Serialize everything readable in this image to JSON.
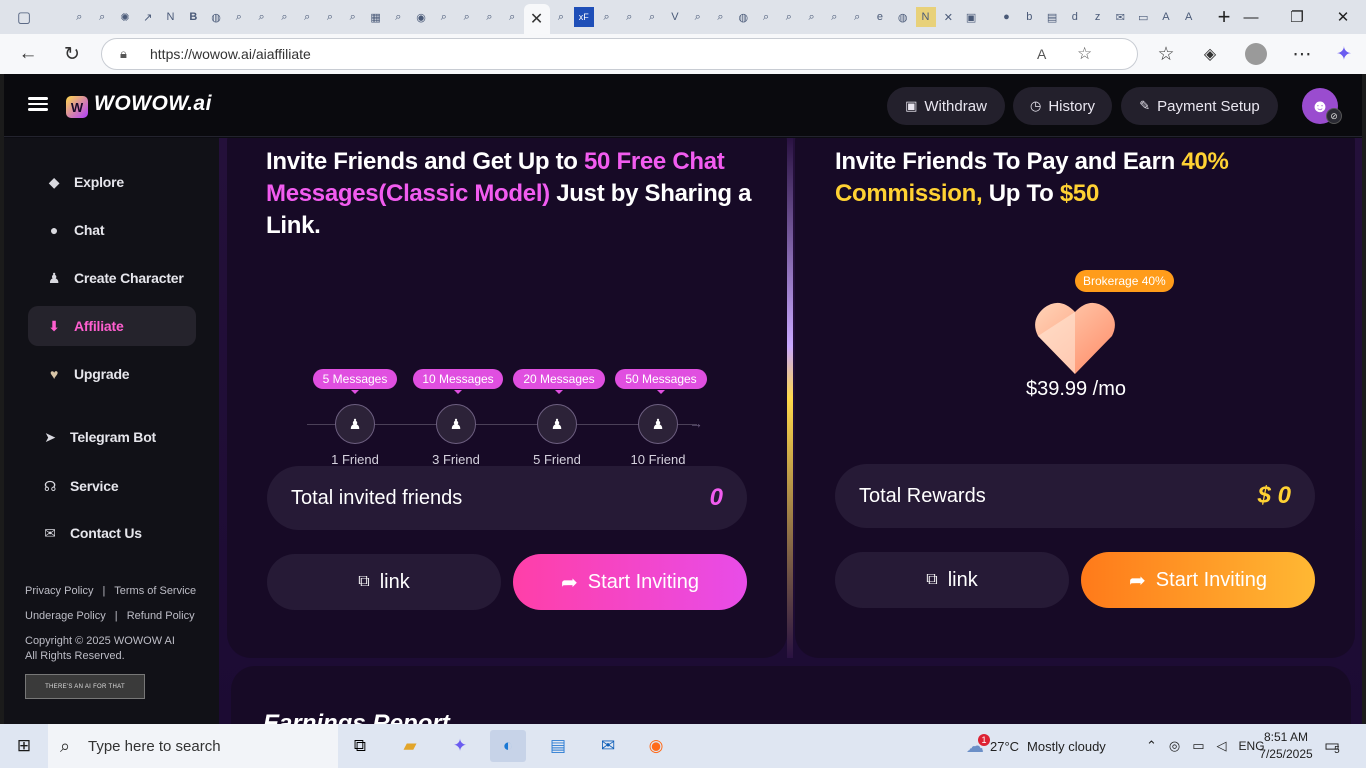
{
  "browser": {
    "url": "https://wowow.ai/aiaffiliate",
    "active_tab_close": "✕",
    "new_tab": "+",
    "win_minimize": "—",
    "win_restore": "❐",
    "win_close": "✕"
  },
  "header": {
    "logo": "WOWOW.ai",
    "buttons": [
      {
        "label": "Withdraw",
        "icon": "wallet-icon"
      },
      {
        "label": "History",
        "icon": "history-icon"
      },
      {
        "label": "Payment Setup",
        "icon": "edit-icon"
      }
    ]
  },
  "sidebar": {
    "items": [
      {
        "label": "Explore",
        "icon": "compass-icon"
      },
      {
        "label": "Chat",
        "icon": "chat-icon"
      },
      {
        "label": "Create Character",
        "icon": "user-icon"
      },
      {
        "label": "Affiliate",
        "icon": "affiliate-icon"
      },
      {
        "label": "Upgrade",
        "icon": "heart-icon"
      },
      {
        "label": "Telegram Bot",
        "icon": "telegram-icon"
      },
      {
        "label": "Service",
        "icon": "headset-icon"
      },
      {
        "label": "Contact Us",
        "icon": "mail-icon"
      }
    ],
    "footer": {
      "privacy": "Privacy Policy",
      "sep": "|",
      "terms": "Terms of Service",
      "underage": "Underage Policy",
      "refund": "Refund Policy",
      "copyright": "Copyright © 2025 WOWOW AI",
      "rights": "All Rights Reserved.",
      "badge": "THERE'S AN AI FOR THAT"
    }
  },
  "invite_card": {
    "title_a": "Invite Friends and Get Up to ",
    "title_b": "50 Free Chat Messages(Classic Model)",
    "title_c": " Just by Sharing a Link.",
    "steps": [
      {
        "messages": "5 Messages",
        "friends": "1 Friend"
      },
      {
        "messages": "10 Messages",
        "friends": "3 Friend"
      },
      {
        "messages": "20 Messages",
        "friends": "5 Friend"
      },
      {
        "messages": "50 Messages",
        "friends": "10 Friend"
      }
    ],
    "stat_label": "Total invited friends",
    "stat_value": "0",
    "link_label": "link",
    "invite_label": "Start Inviting"
  },
  "earn_card": {
    "title_a": "Invite Friends To Pay and Earn ",
    "title_b": "40%",
    "title_c": "Commission,",
    "title_d": " Up To ",
    "title_e": "$50",
    "brokerage": "Brokerage  40%",
    "price": "$39.99 /mo",
    "stat_label": "Total Rewards",
    "stat_value": "$ 0",
    "link_label": "link",
    "invite_label": "Start Inviting"
  },
  "earnings": {
    "title": "Earnings Report"
  },
  "taskbar": {
    "search_placeholder": "Type here to search",
    "weather_temp": "27°C",
    "weather_text": "Mostly cloudy",
    "lang": "ENG",
    "time": "8:51 AM",
    "date": "7/25/2025",
    "notif_count": "5",
    "weather_badge": "1"
  },
  "colors": {
    "accent_pink": "#f25cf0",
    "accent_gold": "#ffd233",
    "invite_gradient_pink": "#ff3fa8",
    "invite_gradient_orange": "#ff7a1a"
  }
}
